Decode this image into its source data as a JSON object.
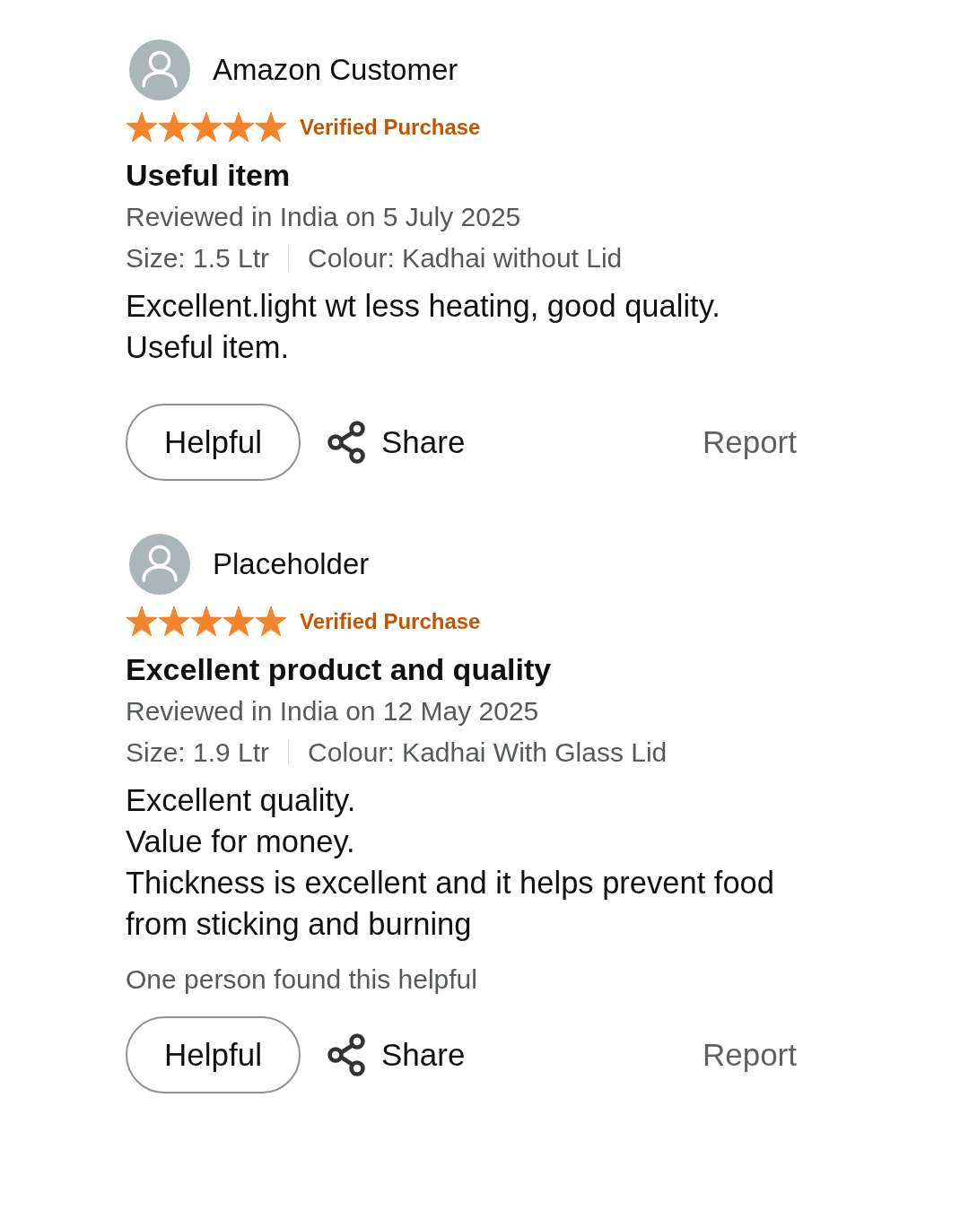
{
  "reviews": [
    {
      "reviewer": "Amazon Customer",
      "stars": 5,
      "badge": "Verified Purchase",
      "title": "Useful item",
      "date": "Reviewed in India on 5 July 2025",
      "size": "Size: 1.5 Ltr",
      "colour": "Colour: Kadhai without Lid",
      "body": "Excellent.light wt less heating, good quality.\nUseful item.",
      "helpful_button": "Helpful",
      "share_button": "Share",
      "report_link": "Report"
    },
    {
      "reviewer": "Placeholder",
      "stars": 5,
      "badge": "Verified Purchase",
      "title": "Excellent product and quality",
      "date": "Reviewed in India on 12 May 2025",
      "size": "Size: 1.9 Ltr",
      "colour": "Colour: Kadhai With Glass Lid",
      "body": "Excellent quality.\nValue for money.\nThickness is excellent and it helps prevent food from sticking and burning",
      "helpful_count": "One person found this helpful",
      "helpful_button": "Helpful",
      "share_button": "Share",
      "report_link": "Report"
    }
  ]
}
